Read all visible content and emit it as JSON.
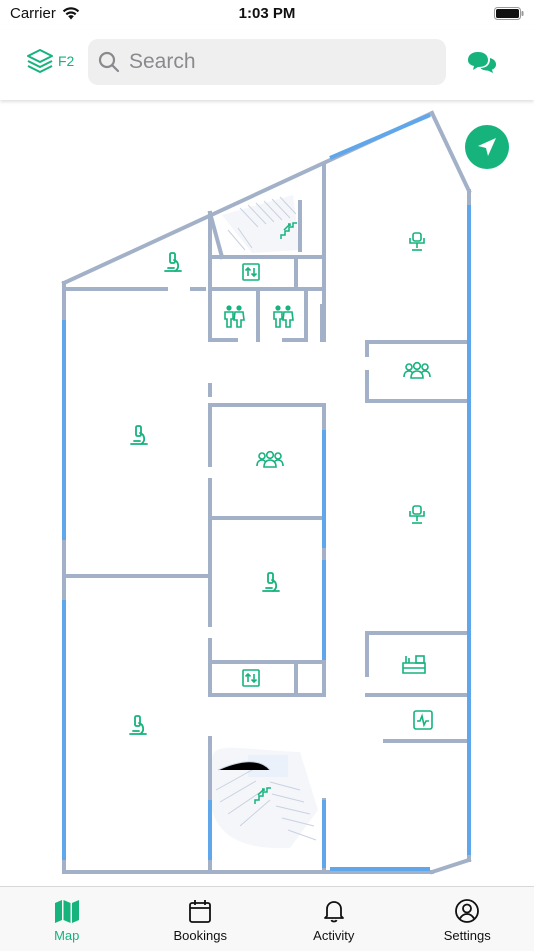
{
  "status_bar": {
    "carrier": "Carrier",
    "time": "1:03 PM"
  },
  "header": {
    "floor_label": "F2",
    "search_placeholder": "Search"
  },
  "colors": {
    "accent": "#16b37c",
    "wall": "#a3b1c8",
    "window": "#5fa7ea"
  },
  "map": {
    "icons": [
      "microscope-icon",
      "elevator-icon",
      "restroom-icon",
      "stairs-icon",
      "office-chair-icon",
      "meeting-room-icon",
      "reception-desk-icon",
      "monitor-icon"
    ]
  },
  "tabs": [
    {
      "label": "Map",
      "icon": "map-icon",
      "active": true
    },
    {
      "label": "Bookings",
      "icon": "calendar-icon",
      "active": false
    },
    {
      "label": "Activity",
      "icon": "bell-icon",
      "active": false
    },
    {
      "label": "Settings",
      "icon": "user-circle-icon",
      "active": false
    }
  ]
}
